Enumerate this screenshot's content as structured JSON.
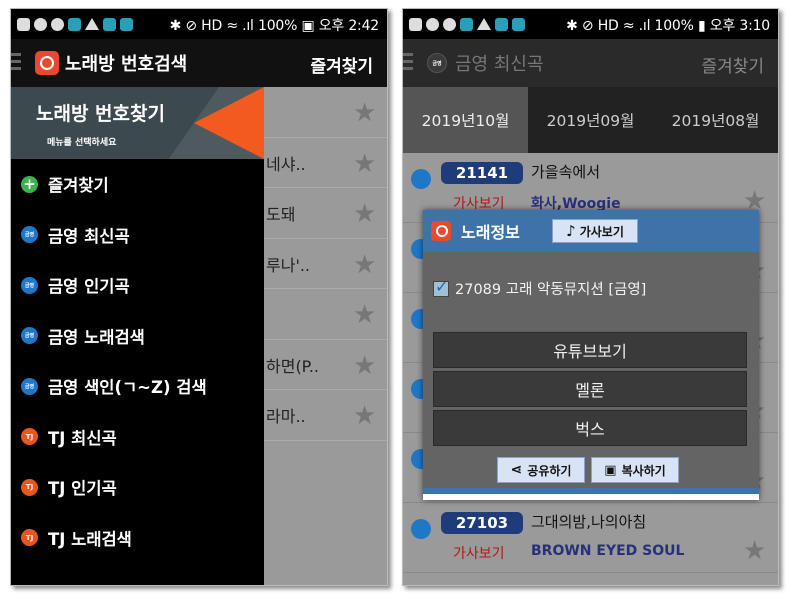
{
  "left_screen": {
    "status": {
      "right_text": "✱ ⊘ HD ≈ .ıl 100% ▣ 오후 2:42"
    },
    "appbar": {
      "title": "노래방 번호검색",
      "favorites": "즐겨찾기"
    },
    "background_rows": [
      "",
      "네샤..",
      "도돼",
      "루나'..",
      "",
      "하면(P..",
      "라마.."
    ],
    "drawer": {
      "header_title": "노래방 번호찾기",
      "header_subtitle": "메뉴를 선택하세요",
      "items": [
        {
          "label": "즐겨찾기",
          "icon": "plus-icon",
          "badge": "+"
        },
        {
          "label": "금영 최신곡",
          "icon": "ky-icon",
          "badge": "금영"
        },
        {
          "label": "금영 인기곡",
          "icon": "ky-icon",
          "badge": "금영"
        },
        {
          "label": "금영 노래검색",
          "icon": "ky-icon",
          "badge": "금영"
        },
        {
          "label": "금영 색인(ㄱ~Z) 검색",
          "icon": "ky-icon",
          "badge": "금영"
        },
        {
          "label": "TJ 최신곡",
          "icon": "tj-icon",
          "badge": "TJ"
        },
        {
          "label": "TJ 인기곡",
          "icon": "tj-icon",
          "badge": "TJ"
        },
        {
          "label": "TJ 노래검색",
          "icon": "tj-icon",
          "badge": "TJ"
        }
      ]
    }
  },
  "right_screen": {
    "status": {
      "right_text": "✱ ⊘ HD ≈ .ıl 100% ▮ 오후 3:10"
    },
    "appbar": {
      "title": "금영 최신곡",
      "favorites": "즐겨찾기"
    },
    "tabs": [
      "2019년10월",
      "2019년09월",
      "2019년08월"
    ],
    "songs": [
      {
        "number": "21141",
        "title": "가을속에서",
        "lyrics": "가사보기",
        "artist": "화사,Woogie"
      },
      {
        "number": "",
        "title": "",
        "lyrics": "",
        "artist": ""
      },
      {
        "number": "",
        "title": "",
        "lyrics": "",
        "artist": ""
      },
      {
        "number": "",
        "title": "",
        "lyrics": "",
        "artist": ""
      },
      {
        "number": "",
        "title": "",
        "lyrics": "",
        "artist": ""
      },
      {
        "number": "27103",
        "title": "그대의밤,나의아침",
        "lyrics": "가사보기",
        "artist": "BROWN EYED SOUL"
      }
    ],
    "dialog": {
      "title": "노래정보",
      "lyrics_button": "가사보기",
      "song_entry": "27089 고래 악동뮤지션 [금영]",
      "actions": [
        "유튜브보기",
        "멜론",
        "벅스"
      ],
      "share_button": "공유하기",
      "copy_button": "복사하기"
    }
  },
  "colors": {
    "ky_blue": "#1f77c8",
    "tj_orange": "#e8561e",
    "dialog_header": "#3d73a9",
    "number_pill": "#1f3c7a"
  }
}
